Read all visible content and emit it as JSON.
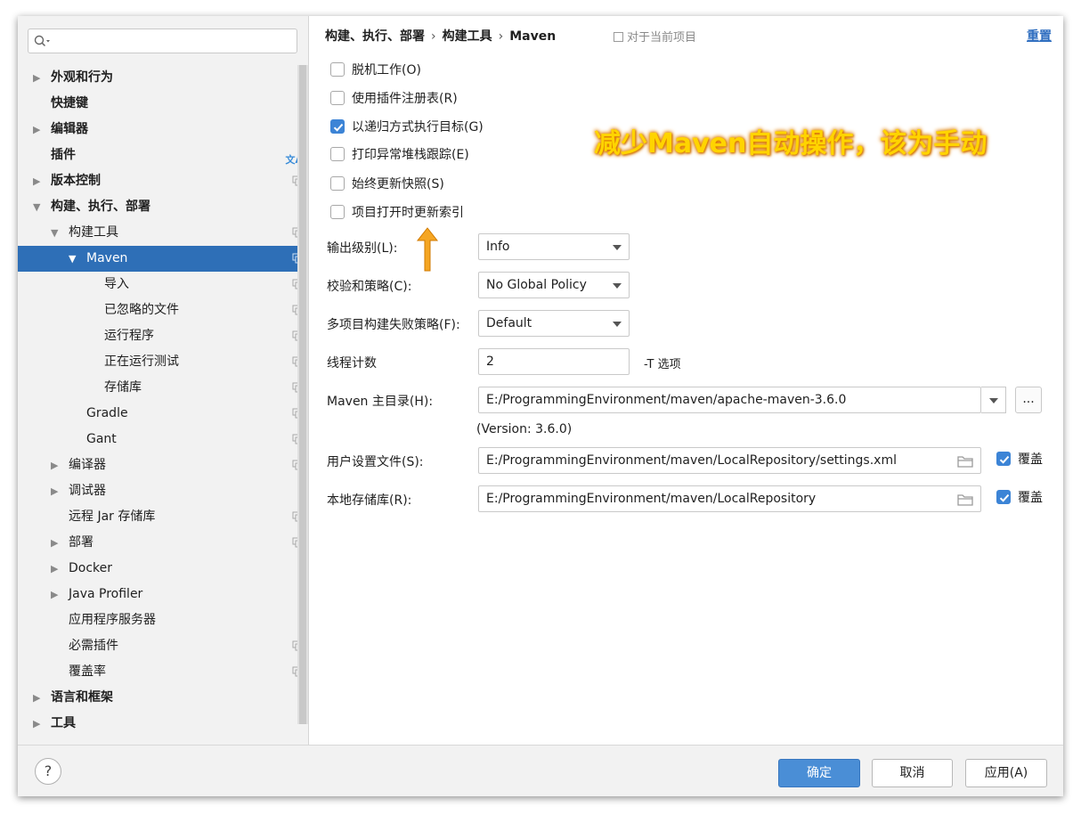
{
  "sidebar": {
    "search": {
      "placeholder": "",
      "value": ""
    },
    "items": [
      {
        "label": "外观和行为",
        "bold": true,
        "arrow": "right",
        "level": 0,
        "icon": ""
      },
      {
        "label": "快捷键",
        "bold": true,
        "arrow": "",
        "level": 0,
        "icon": ""
      },
      {
        "label": "编辑器",
        "bold": true,
        "arrow": "right",
        "level": 0,
        "icon": ""
      },
      {
        "label": "插件",
        "bold": true,
        "arrow": "",
        "level": 0,
        "icon": "translate-icon"
      },
      {
        "label": "版本控制",
        "bold": true,
        "arrow": "right",
        "level": 0,
        "icon": "copy-icon"
      },
      {
        "label": "构建、执行、部署",
        "bold": true,
        "arrow": "down",
        "level": 0,
        "icon": ""
      },
      {
        "label": "构建工具",
        "bold": false,
        "arrow": "down",
        "level": 1,
        "icon": "copy-icon"
      },
      {
        "label": "Maven",
        "bold": false,
        "arrow": "down",
        "level": 2,
        "icon": "copy-icon",
        "selected": true
      },
      {
        "label": "导入",
        "bold": false,
        "arrow": "",
        "level": 3,
        "icon": "copy-icon"
      },
      {
        "label": "已忽略的文件",
        "bold": false,
        "arrow": "",
        "level": 3,
        "icon": "copy-icon"
      },
      {
        "label": "运行程序",
        "bold": false,
        "arrow": "",
        "level": 3,
        "icon": "copy-icon"
      },
      {
        "label": "正在运行测试",
        "bold": false,
        "arrow": "",
        "level": 3,
        "icon": "copy-icon"
      },
      {
        "label": "存储库",
        "bold": false,
        "arrow": "",
        "level": 3,
        "icon": "copy-icon"
      },
      {
        "label": "Gradle",
        "bold": false,
        "arrow": "",
        "level": 2,
        "icon": "copy-icon"
      },
      {
        "label": "Gant",
        "bold": false,
        "arrow": "",
        "level": 2,
        "icon": "copy-icon"
      },
      {
        "label": "编译器",
        "bold": false,
        "arrow": "right",
        "level": 1,
        "icon": "copy-icon"
      },
      {
        "label": "调试器",
        "bold": false,
        "arrow": "right",
        "level": 1,
        "icon": ""
      },
      {
        "label": "远程 Jar 存储库",
        "bold": false,
        "arrow": "",
        "level": 1,
        "icon": "copy-icon"
      },
      {
        "label": "部署",
        "bold": false,
        "arrow": "right",
        "level": 1,
        "icon": "copy-icon"
      },
      {
        "label": "Docker",
        "bold": false,
        "arrow": "right",
        "level": 1,
        "icon": ""
      },
      {
        "label": "Java Profiler",
        "bold": false,
        "arrow": "right",
        "level": 1,
        "icon": ""
      },
      {
        "label": "应用程序服务器",
        "bold": false,
        "arrow": "",
        "level": 1,
        "icon": ""
      },
      {
        "label": "必需插件",
        "bold": false,
        "arrow": "",
        "level": 1,
        "icon": "copy-icon"
      },
      {
        "label": "覆盖率",
        "bold": false,
        "arrow": "",
        "level": 1,
        "icon": "copy-icon"
      },
      {
        "label": "语言和框架",
        "bold": true,
        "arrow": "right",
        "level": 0,
        "icon": ""
      },
      {
        "label": "工具",
        "bold": true,
        "arrow": "right",
        "level": 0,
        "icon": ""
      }
    ]
  },
  "header": {
    "breadcrumb": [
      "构建、执行、部署",
      "构建工具",
      "Maven"
    ],
    "breadcrumb_sep": "›",
    "scope": "对于当前项目",
    "reset": "重置"
  },
  "options": {
    "offline": {
      "label": "脱机工作(O)",
      "checked": false
    },
    "plugin_registry": {
      "label": "使用插件注册表(R)",
      "checked": false
    },
    "recursive": {
      "label": "以递归方式执行目标(G)",
      "checked": true
    },
    "stack_trace": {
      "label": "打印异常堆栈跟踪(E)",
      "checked": false
    },
    "always_update": {
      "label": "始终更新快照(S)",
      "checked": false
    },
    "update_index": {
      "label": "项目打开时更新索引",
      "checked": false
    }
  },
  "fields": {
    "output_level": {
      "label": "输出级别(L):",
      "value": "Info"
    },
    "checksum_policy": {
      "label": "校验和策略(C):",
      "value": "No Global Policy"
    },
    "failure_policy": {
      "label": "多项目构建失败策略(F):",
      "value": "Default"
    },
    "thread_count": {
      "label": "线程计数",
      "value": "2",
      "suffix": "-T 选项"
    },
    "maven_home": {
      "label": "Maven 主目录(H):",
      "value": "E:/ProgrammingEnvironment/maven/apache-maven-3.6.0",
      "browse": "...",
      "version": "(Version: 3.6.0)"
    },
    "settings_file": {
      "label": "用户设置文件(S):",
      "value": "E:/ProgrammingEnvironment/maven/LocalRepository/settings.xml",
      "override_label": "覆盖",
      "override": true
    },
    "local_repo": {
      "label": "本地存储库(R):",
      "value": "E:/ProgrammingEnvironment/maven/LocalRepository",
      "override_label": "覆盖",
      "override": true
    }
  },
  "annotation": {
    "text": "减少Maven自动操作，该为手动"
  },
  "footer": {
    "help": "?",
    "ok": "确定",
    "cancel": "取消",
    "apply": "应用(A)"
  },
  "colors": {
    "selection": "#2e6fb7",
    "checkbox": "#3c84d6",
    "primary_button": "#4a8ed6",
    "annotation": "#ffd400",
    "annotation_arrow": "#f5a623",
    "link": "#2f6ec0"
  }
}
